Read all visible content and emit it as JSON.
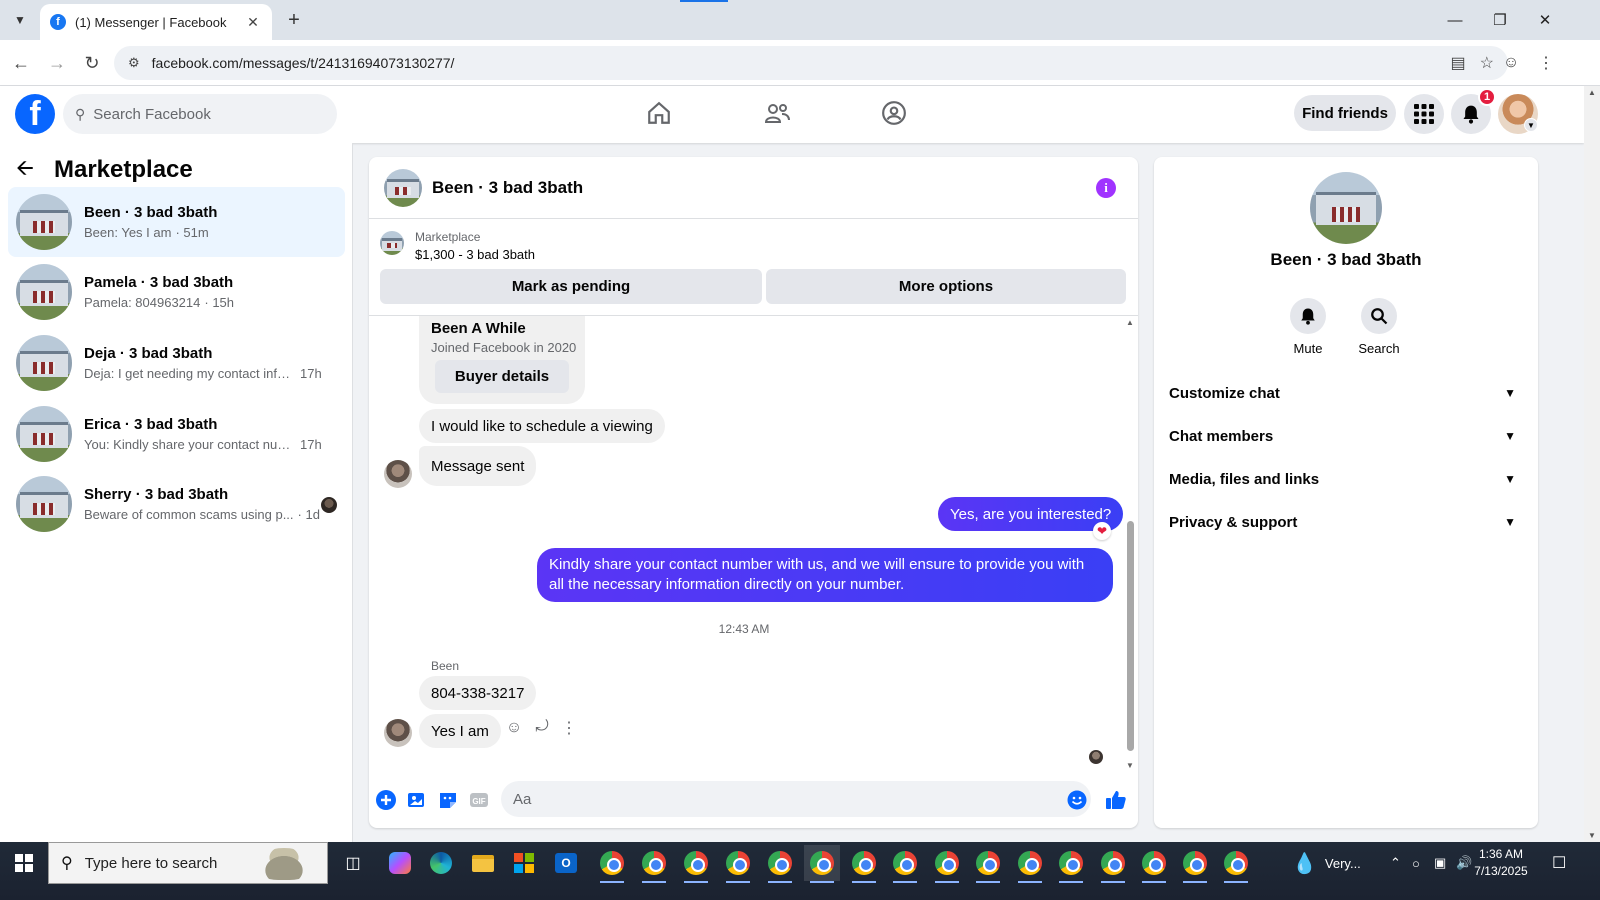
{
  "browser": {
    "tab_title": "(1) Messenger | Facebook",
    "url": "facebook.com/messages/t/24131694073130277/"
  },
  "fb_header": {
    "search_placeholder": "Search Facebook",
    "find_friends": "Find friends",
    "notification_count": "1"
  },
  "sidebar": {
    "title": "Marketplace",
    "conversations": [
      {
        "name": "Been · 3 bad 3bath",
        "preview": "Been: Yes I am",
        "time": "· 51m",
        "active": true
      },
      {
        "name": "Pamela · 3 bad 3bath",
        "preview": "Pamela: 804963214",
        "time": "· 15h"
      },
      {
        "name": "Deja · 3 bad 3bath",
        "preview": "Deja: I get needing my contact info t...",
        "time": "17h"
      },
      {
        "name": "Erica · 3 bad 3bath",
        "preview": "You: Kindly share your contact numb...",
        "time": "17h"
      },
      {
        "name": "Sherry · 3 bad 3bath",
        "preview": "Beware of common scams using p...",
        "time": "· 1d"
      }
    ]
  },
  "chat": {
    "title": "Been · 3 bad 3bath",
    "marketplace_label": "Marketplace",
    "listing": "$1,300 - 3 bad 3bath",
    "mark_pending": "Mark as pending",
    "more_options": "More options",
    "buyer_card": {
      "name": "Been A While",
      "joined": "Joined Facebook in 2020",
      "button": "Buyer details"
    },
    "messages": [
      {
        "text": "I would like to schedule a viewing",
        "dir": "in"
      },
      {
        "text": "Message sent",
        "dir": "in"
      },
      {
        "text": "Yes, are you interested?",
        "dir": "out",
        "reaction": "heart"
      },
      {
        "text": "Kindly share your contact number with us, and we will ensure to provide you with all the necessary information directly on your number.",
        "dir": "out"
      },
      {
        "text": "804-338-3217",
        "dir": "in"
      },
      {
        "text": "Yes I am",
        "dir": "in"
      }
    ],
    "timestamp": "12:43 AM",
    "sender_label": "Been",
    "composer_placeholder": "Aa"
  },
  "info_panel": {
    "name": "Been · 3 bad 3bath",
    "mute": "Mute",
    "search": "Search",
    "sections": [
      "Customize chat",
      "Chat members",
      "Media, files and links",
      "Privacy & support"
    ]
  },
  "taskbar": {
    "search_placeholder": "Type here to search",
    "weather": "Very...",
    "time": "1:36 AM",
    "date": "7/13/2025"
  },
  "colors": {
    "fb_blue": "#0866ff",
    "outgoing_bubble": "#4a3aff",
    "info_purple": "#a033ff",
    "active_row": "#ebf5ff"
  }
}
